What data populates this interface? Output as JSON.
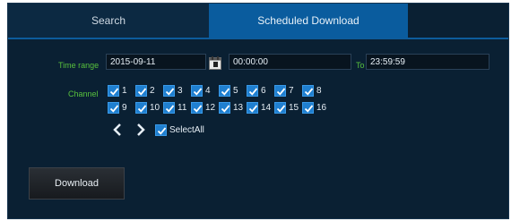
{
  "tabs": [
    {
      "label": "Search"
    },
    {
      "label": "Scheduled Download"
    }
  ],
  "form": {
    "time_range_label": "Time range",
    "start_date": "2015-09-11",
    "start_time": "00:00:00",
    "to_label": "To",
    "end_time": "23:59:59",
    "channel_label": "Channel"
  },
  "channels": [
    "1",
    "2",
    "3",
    "4",
    "5",
    "6",
    "7",
    "8",
    "9",
    "10",
    "11",
    "12",
    "13",
    "14",
    "15",
    "16"
  ],
  "select_all_label": "SelectAll",
  "download_label": "Download",
  "colors": {
    "background": "#0a2033",
    "active_tab": "#0a5c9e",
    "label_green": "#58c13d",
    "checkbox_blue": "#1f7fd0"
  }
}
